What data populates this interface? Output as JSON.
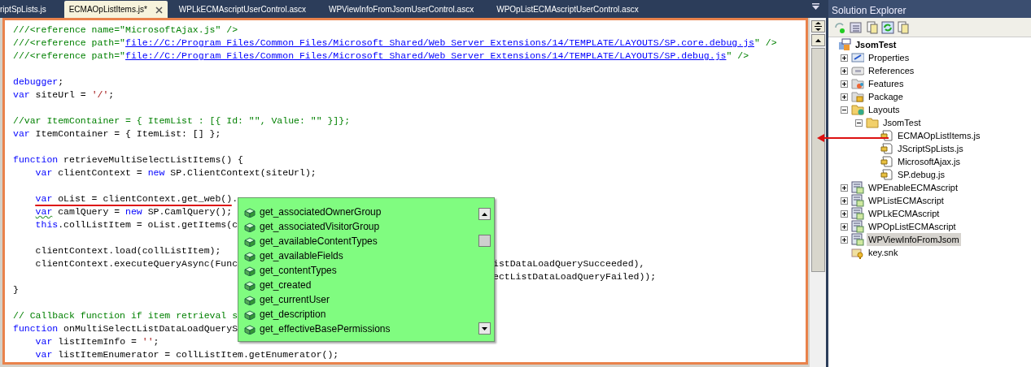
{
  "tabs": [
    {
      "label": "riptSpLists.js",
      "selected": false
    },
    {
      "label": "ECMAOpListItems.js*",
      "selected": true
    },
    {
      "label": "WPLkECMAscriptUserControl.ascx",
      "selected": false
    },
    {
      "label": "WPViewInfoFromJsomUserControl.ascx",
      "selected": false
    },
    {
      "label": "WPOpListECMAscriptUserControl.ascx",
      "selected": false
    }
  ],
  "editor": {
    "lines": [
      {
        "kind": "code",
        "indented": false,
        "tokens": [
          {
            "kind": "comment",
            "text": "///<reference name=\"MicrosoftAjax.js\" />"
          }
        ]
      },
      {
        "kind": "code",
        "indented": false,
        "tokens": [
          {
            "kind": "comment",
            "text": "///<reference path=\""
          },
          {
            "kind": "link",
            "text": "file://C:/Program Files/Common Files/Microsoft Shared/Web Server Extensions/14/TEMPLATE/LAYOUTS/SP.core.debug.js"
          },
          {
            "kind": "comment",
            "text": "\" />"
          }
        ]
      },
      {
        "kind": "code",
        "indented": false,
        "tokens": [
          {
            "kind": "comment",
            "text": "///<reference path=\""
          },
          {
            "kind": "link",
            "text": "file://C:/Program Files/Common Files/Microsoft Shared/Web Server Extensions/14/TEMPLATE/LAYOUTS/SP.debug.js"
          },
          {
            "kind": "comment",
            "text": "\" />"
          }
        ]
      },
      {
        "kind": "blank"
      },
      {
        "kind": "code",
        "indented": false,
        "tokens": [
          {
            "kind": "keyword",
            "text": "debugger"
          },
          {
            "kind": "plain",
            "text": ";"
          }
        ]
      },
      {
        "kind": "code",
        "indented": false,
        "tokens": [
          {
            "kind": "keyword",
            "text": "var"
          },
          {
            "kind": "plain",
            "text": " siteUrl = "
          },
          {
            "kind": "string",
            "text": "'/'"
          },
          {
            "kind": "plain",
            "text": ";"
          }
        ]
      },
      {
        "kind": "blank"
      },
      {
        "kind": "code",
        "indented": false,
        "tokens": [
          {
            "kind": "comment",
            "text": "//var ItemContainer = { ItemList : [{ Id: \"\", Value: \"\" }]};"
          }
        ]
      },
      {
        "kind": "code",
        "indented": false,
        "tokens": [
          {
            "kind": "keyword",
            "text": "var"
          },
          {
            "kind": "plain",
            "text": " ItemContainer = { ItemList: [] };"
          }
        ]
      },
      {
        "kind": "blank"
      },
      {
        "kind": "code",
        "indented": false,
        "tokens": [
          {
            "kind": "keyword",
            "text": "function"
          },
          {
            "kind": "plain",
            "text": " retrieveMultiSelectListItems() {"
          }
        ]
      },
      {
        "kind": "code",
        "indented": true,
        "tokens": [
          {
            "kind": "keyword",
            "text": "var"
          },
          {
            "kind": "plain",
            "text": " clientContext = "
          },
          {
            "kind": "keyword",
            "text": "new"
          },
          {
            "kind": "plain",
            "text": " SP.ClientContext(siteUrl);"
          }
        ]
      },
      {
        "kind": "blank"
      },
      {
        "kind": "code",
        "indented": true,
        "tokens": [
          {
            "kind": "keyword",
            "text": "var"
          },
          {
            "kind": "plain",
            "text": " oList = clientContext.get_web()."
          }
        ]
      },
      {
        "kind": "code",
        "indented": true,
        "tokens": [
          {
            "kind": "keyword",
            "text": "var",
            "squiggle": true
          },
          {
            "kind": "plain",
            "text": " camlQuery = "
          },
          {
            "kind": "keyword",
            "text": "new"
          },
          {
            "kind": "plain",
            "text": " SP.CamlQuery();"
          }
        ]
      },
      {
        "kind": "code",
        "indented": true,
        "tokens": [
          {
            "kind": "keyword",
            "text": "this"
          },
          {
            "kind": "plain",
            "text": ".collListItem = oList.getItems(c"
          }
        ]
      },
      {
        "kind": "blank"
      },
      {
        "kind": "code",
        "indented": true,
        "tokens": [
          {
            "kind": "plain",
            "text": "clientContext.load(collListItem);"
          }
        ]
      },
      {
        "kind": "code",
        "indented": true,
        "tokens": [
          {
            "kind": "plain",
            "text": "clientContext.executeQueryAsync(Func"
          }
        ],
        "tail": [
          {
            "kind": "plain",
            "text": "istDataLoadQuerySucceeded),"
          }
        ]
      },
      {
        "kind": "code",
        "tail": [
          {
            "kind": "plain",
            "text": "ectListDataLoadQueryFailed));"
          }
        ]
      },
      {
        "kind": "code",
        "indented": false,
        "tokens": [
          {
            "kind": "plain",
            "text": "}"
          }
        ]
      },
      {
        "kind": "blank"
      },
      {
        "kind": "code",
        "indented": false,
        "tokens": [
          {
            "kind": "comment",
            "text": "// Callback function if item retrieval s"
          }
        ]
      },
      {
        "kind": "code",
        "indented": false,
        "tokens": [
          {
            "kind": "keyword",
            "text": "function"
          },
          {
            "kind": "plain",
            "text": " onMultiSelectListDataLoadQueryS"
          }
        ]
      },
      {
        "kind": "code",
        "indented": true,
        "tokens": [
          {
            "kind": "keyword",
            "text": "var"
          },
          {
            "kind": "plain",
            "text": " listItemInfo = "
          },
          {
            "kind": "string",
            "text": "''"
          },
          {
            "kind": "plain",
            "text": ";"
          }
        ]
      },
      {
        "kind": "code",
        "indented": true,
        "tokens": [
          {
            "kind": "keyword",
            "text": "var"
          },
          {
            "kind": "plain",
            "text": " listItemEnumerator = collListItem.getEnumerator();"
          }
        ]
      }
    ],
    "completion": {
      "items": [
        {
          "label": "get_associatedOwnerGroup",
          "selected": false
        },
        {
          "label": "get_associatedVisitorGroup",
          "selected": false
        },
        {
          "label": "get_availableContentTypes",
          "selected": false
        },
        {
          "label": "get_availableFields",
          "selected": false
        },
        {
          "label": "get_contentTypes",
          "selected": false
        },
        {
          "label": "get_created",
          "selected": false
        },
        {
          "label": "get_currentUser",
          "selected": false
        },
        {
          "label": "get_description",
          "selected": false
        },
        {
          "label": "get_effectiveBasePermissions",
          "selected": false
        }
      ]
    }
  },
  "solution_explorer": {
    "title": "Solution Explorer",
    "root": {
      "label": "JsomTest",
      "kind": "project",
      "children": [
        {
          "label": "Properties",
          "kind": "properties",
          "expanded": false,
          "selected": false
        },
        {
          "label": "References",
          "kind": "references",
          "expanded": false,
          "selected": false
        },
        {
          "label": "Features",
          "kind": "features",
          "expanded": false,
          "selected": false
        },
        {
          "label": "Package",
          "kind": "package",
          "expanded": false,
          "selected": false
        },
        {
          "label": "Layouts",
          "kind": "webfolder",
          "expanded": true,
          "selected": false,
          "children": [
            {
              "label": "JsomTest",
              "kind": "folder",
              "expanded": true,
              "selected": false,
              "children": [
                {
                  "label": "ECMAOpListItems.js",
                  "kind": "script",
                  "selected": false
                },
                {
                  "label": "JScriptSpLists.js",
                  "kind": "script",
                  "selected": false
                },
                {
                  "label": "MicrosoftAjax.js",
                  "kind": "script",
                  "selected": false
                },
                {
                  "label": "SP.debug.js",
                  "kind": "script",
                  "selected": false
                }
              ]
            }
          ]
        },
        {
          "label": "WPEnableECMAscript",
          "kind": "webpart",
          "expanded": false,
          "selected": false
        },
        {
          "label": "WPListECMAscript",
          "kind": "webpart",
          "expanded": false,
          "selected": false
        },
        {
          "label": "WPLkECMAscript",
          "kind": "webpart",
          "expanded": false,
          "selected": false
        },
        {
          "label": "WPOpListECMAscript",
          "kind": "webpart",
          "expanded": false,
          "selected": false
        },
        {
          "label": "WPViewInfoFromJsom",
          "kind": "webpart",
          "expanded": false,
          "selected": true
        },
        {
          "label": "key.snk",
          "kind": "key",
          "selected": false
        }
      ]
    }
  }
}
